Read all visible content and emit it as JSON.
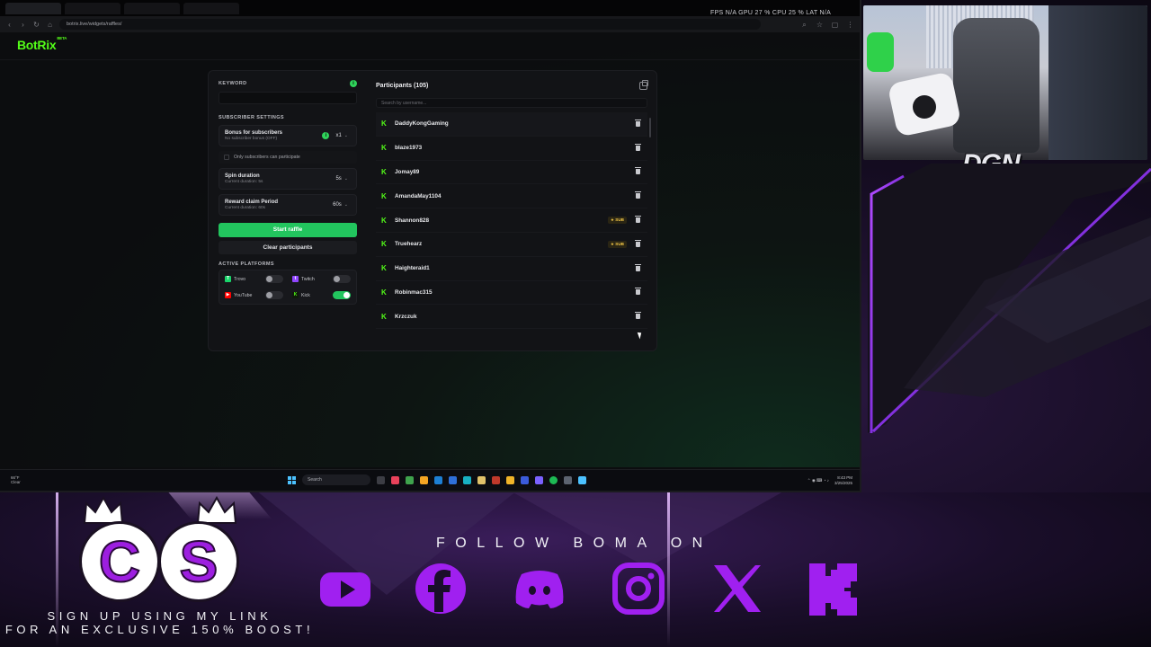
{
  "browser": {
    "tabs": [
      "",
      "",
      "",
      ""
    ],
    "url": "botrix.live/widgets/raffles/",
    "perf": "FPS N/A   GPU 27 %   CPU 25 %   LAT N/A"
  },
  "app": {
    "logo": "BotRix",
    "logo_badge": "BETA"
  },
  "raffle": {
    "keyword_label": "KEYWORD",
    "keyword_value": "",
    "subscriber_settings_label": "SUBSCRIBER SETTINGS",
    "bonus": {
      "title": "Bonus for subscribers",
      "sub": "No subscriber bonus (OFF)",
      "value": "x1"
    },
    "only_subs_label": "Only subscribers can participate",
    "spin": {
      "title": "Spin duration",
      "sub": "Current duration: 5s",
      "value": "5s"
    },
    "reward": {
      "title": "Reward claim Period",
      "sub": "Current duration: 60s",
      "value": "60s"
    },
    "start_button": "Start raffle",
    "clear_button": "Clear participants",
    "active_platforms_label": "ACTIVE PLATFORMS",
    "platforms": [
      {
        "name": "Trovo",
        "enabled": false,
        "color": "#19d66b"
      },
      {
        "name": "Twitch",
        "enabled": false,
        "color": "#9146ff"
      },
      {
        "name": "YouTube",
        "enabled": false,
        "color": "#ff0000"
      },
      {
        "name": "Kick",
        "enabled": true,
        "color": "#53fc18"
      }
    ]
  },
  "participants": {
    "title": "Participants (105)",
    "search_placeholder": "Search by username...",
    "sub_badge": "★ SUB",
    "list": [
      {
        "name": "DaddyKongGaming",
        "sub": false
      },
      {
        "name": "blaze1973",
        "sub": false
      },
      {
        "name": "Jomay89",
        "sub": false
      },
      {
        "name": "AmandaMay1104",
        "sub": false
      },
      {
        "name": "Shannon828",
        "sub": true
      },
      {
        "name": "Truehearz",
        "sub": true
      },
      {
        "name": "Haighteraid1",
        "sub": false
      },
      {
        "name": "Robinmac315",
        "sub": false
      },
      {
        "name": "Krzczuk",
        "sub": false
      }
    ]
  },
  "taskbar": {
    "weather_temp": "66°F",
    "weather_desc": "Clear",
    "search": "Search",
    "time": "8:43 PM",
    "date": "3/25/2025"
  },
  "overlay": {
    "streamer_tag": "DGN",
    "follow_text": "FOLLOW BOMA ON",
    "cs_letters": [
      "C",
      "S"
    ],
    "signup_line1": "SIGN UP USING MY LINK",
    "signup_line2": "FOR AN EXCLUSIVE 150% BOOST!",
    "socials": [
      "youtube-icon",
      "facebook-icon",
      "discord-icon",
      "instagram-icon",
      "x-icon",
      "kick-icon"
    ],
    "accent": "#a020f0"
  }
}
